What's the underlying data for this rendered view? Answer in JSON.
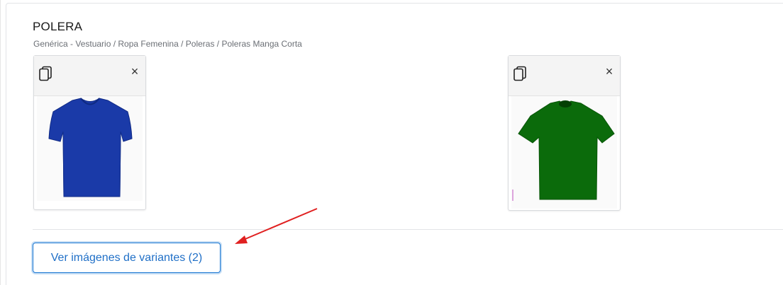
{
  "product": {
    "title": "POLERA",
    "breadcrumb": "Genérica - Vestuario / Ropa Femenina / Poleras / Poleras Manga Corta"
  },
  "cards": [
    {
      "image_alt": "Polera azul",
      "color": "#1a3aa8",
      "copy_icon": "copy-icon",
      "close_icon": "close-icon",
      "close_glyph": "×"
    },
    {
      "image_alt": "Polera verde",
      "color": "#0b6b0b",
      "copy_icon": "copy-icon",
      "close_icon": "close-icon",
      "close_glyph": "×"
    }
  ],
  "actions": {
    "variants_button_label": "Ver imágenes de variantes (2)"
  },
  "annotation": {
    "arrow_color": "#e02020"
  }
}
